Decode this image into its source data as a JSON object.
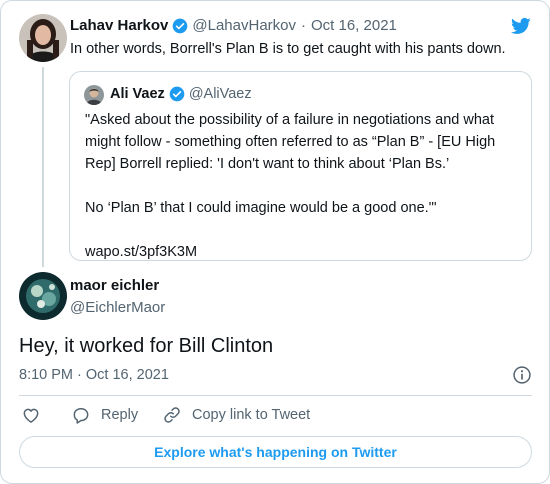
{
  "brand": {
    "accent": "#1d9bf0",
    "logo_icon": "twitter-bird-icon"
  },
  "parent_tweet": {
    "author_name": "Lahav Harkov",
    "author_handle": "@LahavHarkov",
    "separator": "·",
    "date": "Oct 16, 2021",
    "text": "In other words, Borrell's Plan B is to get caught with his pants down."
  },
  "quoted_tweet": {
    "author_name": "Ali Vaez",
    "author_handle": "@AliVaez",
    "paragraphs": [
      "\"Asked about the possibility of a failure in negotiations and what might follow - something often referred to as “Plan B” - [EU High Rep] Borrell replied: 'I don't want to think about ‘Plan Bs.’",
      "No ‘Plan B’ that I could imagine would be a good one.'\"",
      "wapo.st/3pf3K3M"
    ]
  },
  "reply_tweet": {
    "author_name": "maor eichler",
    "author_handle": "@EichlerMaor",
    "text": "Hey, it worked for Bill Clinton",
    "timestamp": "8:10 PM · Oct 16, 2021"
  },
  "actions": {
    "like_icon": "heart-icon",
    "reply_label": "Reply",
    "copy_link_label": "Copy link to Tweet"
  },
  "footer": {
    "explore_label": "Explore what's happening on Twitter"
  }
}
